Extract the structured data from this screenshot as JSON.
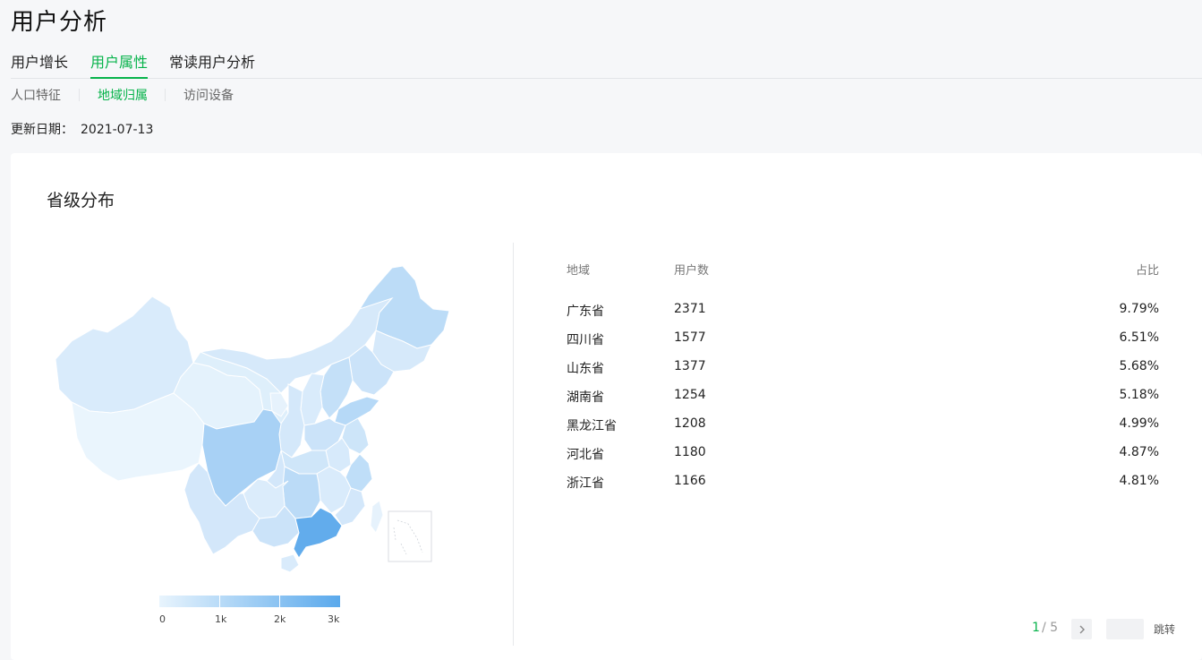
{
  "header": {
    "title": "用户分析"
  },
  "tabs": [
    {
      "label": "用户增长"
    },
    {
      "label": "用户属性"
    },
    {
      "label": "常读用户分析"
    }
  ],
  "subtabs": [
    {
      "label": "人口特征"
    },
    {
      "label": "地域归属"
    },
    {
      "label": "访问设备"
    }
  ],
  "update": {
    "label": "更新日期：",
    "date": "2021-07-13"
  },
  "section": {
    "title": "省级分布"
  },
  "legend": {
    "ticks": [
      "0",
      "1k",
      "2k",
      "3k"
    ]
  },
  "table": {
    "headers": {
      "region": "地域",
      "users": "用户数",
      "ratio": "占比"
    },
    "rows": [
      {
        "region": "广东省",
        "users": "2371",
        "ratio": "9.79%"
      },
      {
        "region": "四川省",
        "users": "1577",
        "ratio": "6.51%"
      },
      {
        "region": "山东省",
        "users": "1377",
        "ratio": "5.68%"
      },
      {
        "region": "湖南省",
        "users": "1254",
        "ratio": "5.18%"
      },
      {
        "region": "黑龙江省",
        "users": "1208",
        "ratio": "4.99%"
      },
      {
        "region": "河北省",
        "users": "1180",
        "ratio": "4.87%"
      },
      {
        "region": "浙江省",
        "users": "1166",
        "ratio": "4.81%"
      }
    ]
  },
  "pagination": {
    "current": "1",
    "separator": "/ 5",
    "next_icon": "chevron-right-icon",
    "jump_label": "跳转",
    "jump_value": ""
  },
  "colors": {
    "accent": "#07b34b",
    "map_low": "#e8f4fd",
    "map_high": "#5aa9ec"
  }
}
